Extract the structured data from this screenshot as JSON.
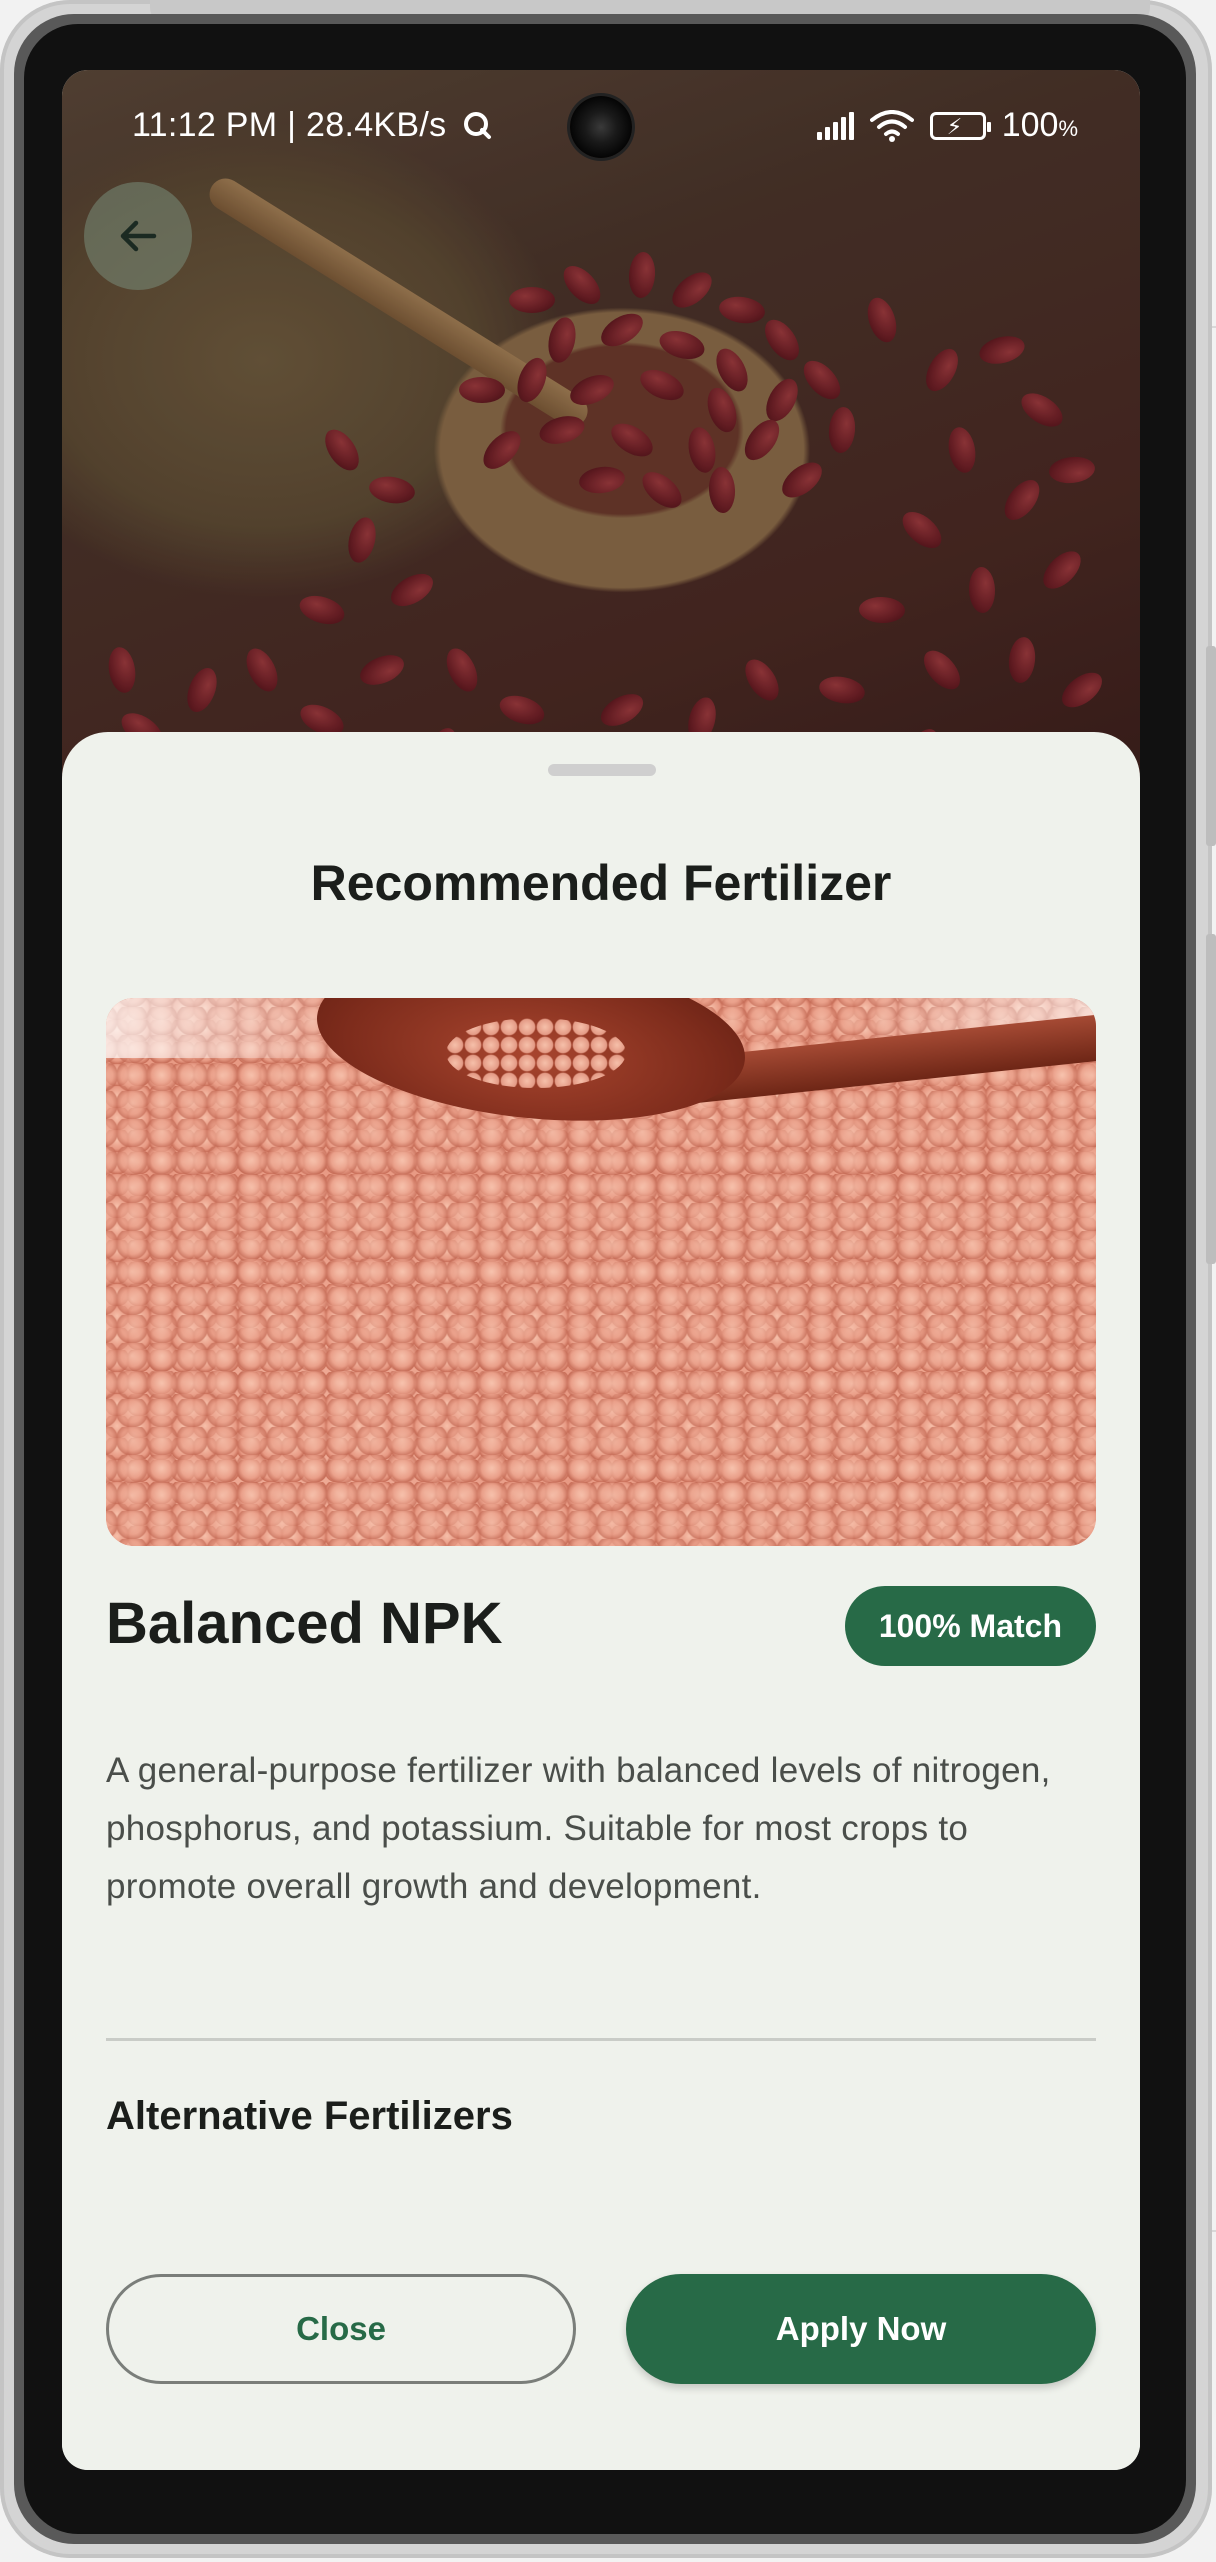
{
  "status_bar": {
    "time_speed": "11:12 PM | 28.4KB/s",
    "battery_percent": "100",
    "battery_unit": "%"
  },
  "header": {
    "back_icon": "arrow-left-icon"
  },
  "sheet": {
    "title": "Recommended Fertilizer",
    "product_name": "Balanced NPK",
    "match_badge": "100% Match",
    "description": "A general-purpose fertilizer with balanced levels of nitrogen, phosphorus, and potassium. Suitable for most crops to promote overall growth and development.",
    "alternatives_title": "Alternative Fertilizers",
    "close_label": "Close",
    "apply_label": "Apply Now"
  },
  "colors": {
    "accent": "#276a47",
    "sheet_background": "#eff2ec",
    "text_primary": "#1b1e1b",
    "text_secondary": "#4a4e4a"
  }
}
